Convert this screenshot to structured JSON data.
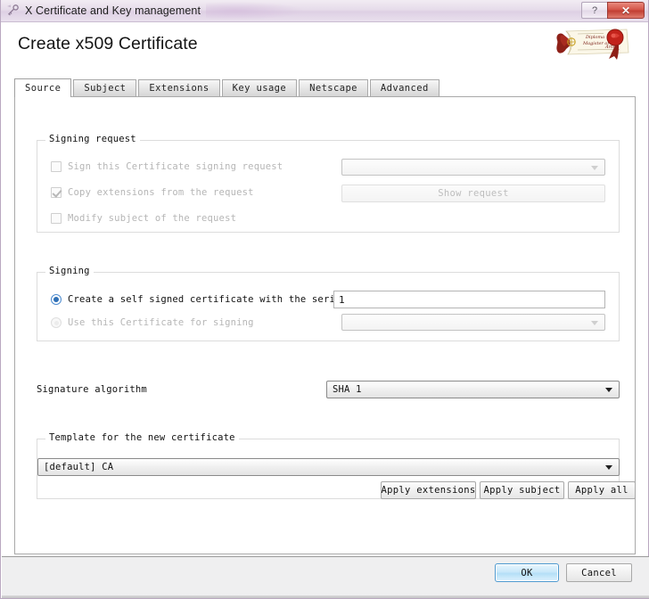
{
  "window": {
    "title": "X Certificate and Key management",
    "icon": "key-certificate-icon",
    "help_label": "?",
    "close_label": "✕"
  },
  "header": {
    "page_title": "Create x509 Certificate",
    "logo": "certificate-diploma-logo"
  },
  "tabs": [
    {
      "label": "Source",
      "active": true
    },
    {
      "label": "Subject",
      "active": false
    },
    {
      "label": "Extensions",
      "active": false
    },
    {
      "label": "Key usage",
      "active": false
    },
    {
      "label": "Netscape",
      "active": false
    },
    {
      "label": "Advanced",
      "active": false
    }
  ],
  "signing_request": {
    "group_title": "Signing request",
    "sign_csr": {
      "label": "Sign this Certificate signing request",
      "checked": false,
      "enabled": false
    },
    "copy_extensions": {
      "label": "Copy extensions from the request",
      "checked": true,
      "enabled": false
    },
    "modify_subject": {
      "label": "Modify subject of the request",
      "checked": false,
      "enabled": false
    },
    "request_combo_value": "",
    "show_request_label": "Show request"
  },
  "signing": {
    "group_title": "Signing",
    "self_signed": {
      "label": "Create a self signed certificate with the serial",
      "selected": true,
      "enabled": true
    },
    "serial_value": "1",
    "use_certificate": {
      "label": "Use this Certificate for signing",
      "selected": false,
      "enabled": false
    },
    "certificate_combo_value": ""
  },
  "signature": {
    "label": "Signature algorithm",
    "value": "SHA 1"
  },
  "template": {
    "group_title": "Template for the new certificate",
    "value": "[default] CA",
    "apply_extensions_label": "Apply extensions",
    "apply_subject_label": "Apply subject",
    "apply_all_label": "Apply all"
  },
  "footer": {
    "ok_label": "OK",
    "cancel_label": "Cancel"
  },
  "colors": {
    "titlebar": "#e6dcea",
    "close_button": "#c23f33",
    "accent_radio": "#2f6fb5",
    "primary_button": "#b4dff7",
    "panel_bg": "#ffffff",
    "footer_bg": "#efeff0"
  }
}
